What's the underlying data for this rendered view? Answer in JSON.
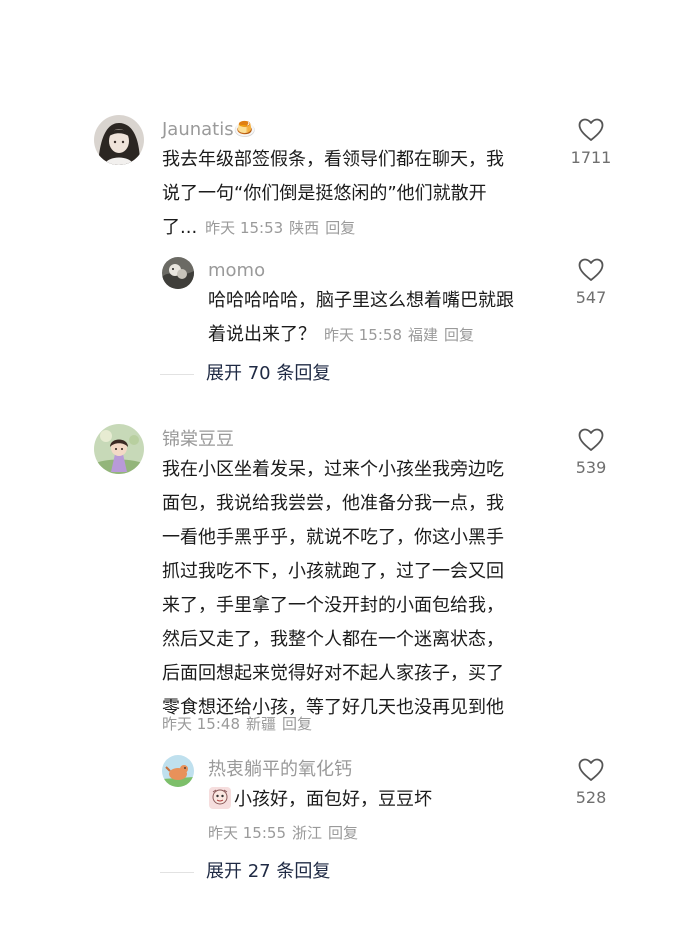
{
  "comments": [
    {
      "username": "Jaunatis🍮",
      "lines": [
        "我去年级部签假条，看领导们都在聊天，我",
        "说了一句“你们倒是挺悠闲的”他们就散开"
      ],
      "last_line": "了...",
      "time": "昨天 15:53",
      "location": "陕西",
      "reply_label": "回复",
      "likes": "1711",
      "replies": [
        {
          "username": "momo",
          "lines": [
            "哈哈哈哈哈，脑子里这么想着嘴巴就跟"
          ],
          "last_line": "着说出来了？",
          "time": "昨天 15:58",
          "location": "福建",
          "reply_label": "回复",
          "likes": "547"
        }
      ],
      "expand_label": "展开 70 条回复"
    },
    {
      "username": "锦棠豆豆",
      "lines": [
        "我在小区坐着发呆，过来个小孩坐我旁边吃",
        "面包，我说给我尝尝，他准备分我一点，我",
        "一看他手黑乎乎，就说不吃了，你这小黑手",
        "抓过我吃不下，小孩就跑了，过了一会又回",
        "来了，手里拿了一个没开封的小面包给我，",
        "然后又走了，我整个人都在一个迷离状态，",
        "后面回想起来觉得好对不起人家孩子，买了",
        "零食想还给小孩，等了好几天也没再见到他"
      ],
      "time": "昨天 15:48",
      "location": "新疆",
      "reply_label": "回复",
      "likes": "539",
      "replies": [
        {
          "username": "热衷躺平的氧化钙",
          "text": "小孩好，面包好，豆豆坏",
          "time": "昨天 15:55",
          "location": "浙江",
          "reply_label": "回复",
          "likes": "528"
        }
      ],
      "expand_label": "展开 27 条回复"
    }
  ]
}
